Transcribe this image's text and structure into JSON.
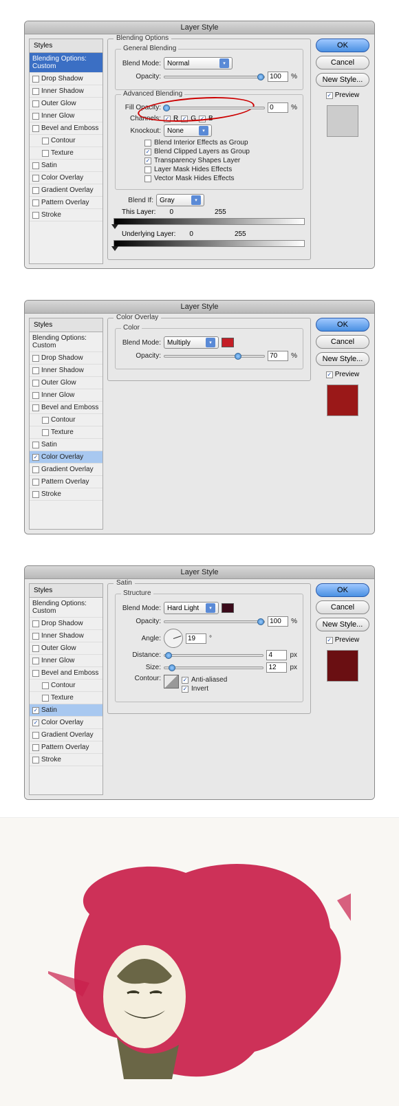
{
  "title": "Layer Style",
  "stylesHeader": "Styles",
  "buttons": {
    "ok": "OK",
    "cancel": "Cancel",
    "newStyle": "New Style...",
    "preview": "Preview"
  },
  "styleItems": [
    "Blending Options: Custom",
    "Drop Shadow",
    "Inner Shadow",
    "Outer Glow",
    "Inner Glow",
    "Bevel and Emboss",
    "Contour",
    "Texture",
    "Satin",
    "Color Overlay",
    "Gradient Overlay",
    "Pattern Overlay",
    "Stroke"
  ],
  "panel1": {
    "group": "Blending Options",
    "general": "General Blending",
    "advanced": "Advanced Blending",
    "blendMode": "Blend Mode:",
    "blendModeVal": "Normal",
    "opacity": "Opacity:",
    "opacityVal": "100",
    "fillOpacity": "Fill Opacity:",
    "fillOpacityVal": "0",
    "channels": "Channels:",
    "r": "R",
    "g": "G",
    "b": "B",
    "knockout": "Knockout:",
    "knockoutVal": "None",
    "opts": [
      "Blend Interior Effects as Group",
      "Blend Clipped Layers as Group",
      "Transparency Shapes Layer",
      "Layer Mask Hides Effects",
      "Vector Mask Hides Effects"
    ],
    "optsChecked": [
      false,
      true,
      true,
      false,
      false
    ],
    "blendIf": "Blend If:",
    "blendIfVal": "Gray",
    "thisLayer": "This Layer:",
    "thisLow": "0",
    "thisHigh": "255",
    "under": "Underlying Layer:",
    "underLow": "0",
    "underHigh": "255",
    "pct": "%"
  },
  "panel2": {
    "group": "Color Overlay",
    "sub": "Color",
    "blendMode": "Blend Mode:",
    "blendModeVal": "Multiply",
    "opacity": "Opacity:",
    "opacityVal": "70",
    "pct": "%",
    "swatchColor": "#c41e26",
    "previewColor": "#9a1818"
  },
  "panel3": {
    "group": "Satin",
    "sub": "Structure",
    "blendMode": "Blend Mode:",
    "blendModeVal": "Hard Light",
    "opacity": "Opacity:",
    "opacityVal": "100",
    "pct": "%",
    "angle": "Angle:",
    "angleVal": "19",
    "deg": "°",
    "distance": "Distance:",
    "distanceVal": "4",
    "px": "px",
    "size": "Size:",
    "sizeVal": "12",
    "contour": "Contour:",
    "aa": "Anti-aliased",
    "invert": "Invert",
    "swatchColor": "#3a0a1a",
    "previewColor": "#6a0f12"
  }
}
